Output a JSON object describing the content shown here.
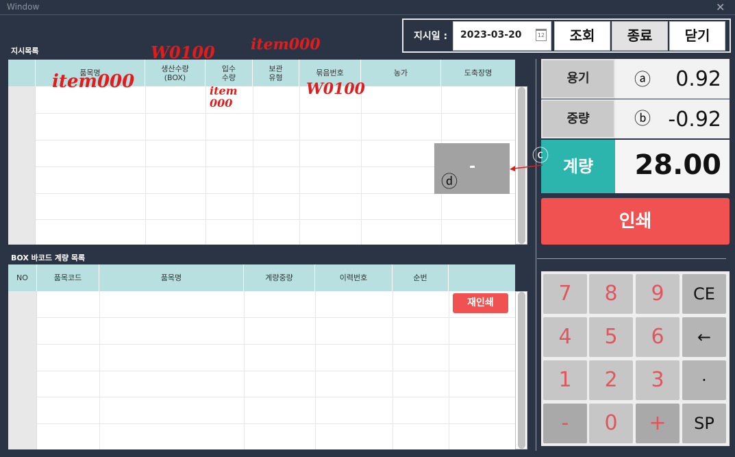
{
  "window": {
    "title": "Window",
    "close_icon": "close-icon"
  },
  "header": {
    "date_label": "지시일 :",
    "date_value": "2023-03-20",
    "calendar_day": "12",
    "buttons": [
      "조회",
      "종료",
      "닫기"
    ]
  },
  "instruction_list": {
    "title": "지시목록",
    "columns": [
      "품목명",
      "생산수량\n(BOX)",
      "입수\n수량",
      "보관\n유형",
      "묶음번호",
      "농가",
      "도축장명"
    ]
  },
  "box_list": {
    "title": "BOX 바코드 계량 목록",
    "columns": [
      "NO",
      "품목코드",
      "품목명",
      "계량중량",
      "이력번호",
      "순번"
    ],
    "reprint_label": "재인쇄"
  },
  "weights": {
    "container": {
      "label": "용기",
      "marker": "ⓐ",
      "value": "0.92"
    },
    "weight": {
      "label": "중량",
      "marker": "ⓑ",
      "value": "-0.92"
    },
    "measure": {
      "label": "계량",
      "value": "28.00"
    },
    "measure_marker": "ⓒ"
  },
  "print_label": "인쇄",
  "keypad": [
    [
      "7",
      "8",
      "9",
      "CE"
    ],
    [
      "4",
      "5",
      "6",
      "←"
    ],
    [
      "1",
      "2",
      "3",
      "·"
    ],
    [
      "-",
      "0",
      "+",
      "SP"
    ]
  ],
  "overlay": {
    "value": "-",
    "marker": "ⓓ"
  },
  "annotations": [
    "item000",
    "W0100",
    "item000",
    "item\n000",
    "W0100"
  ],
  "colors": {
    "background": "#2b3445",
    "table_header": "#b8e0e0",
    "print_red": "#f05252",
    "measure_teal": "#2bb5ac",
    "key_text": "#e0565b"
  }
}
